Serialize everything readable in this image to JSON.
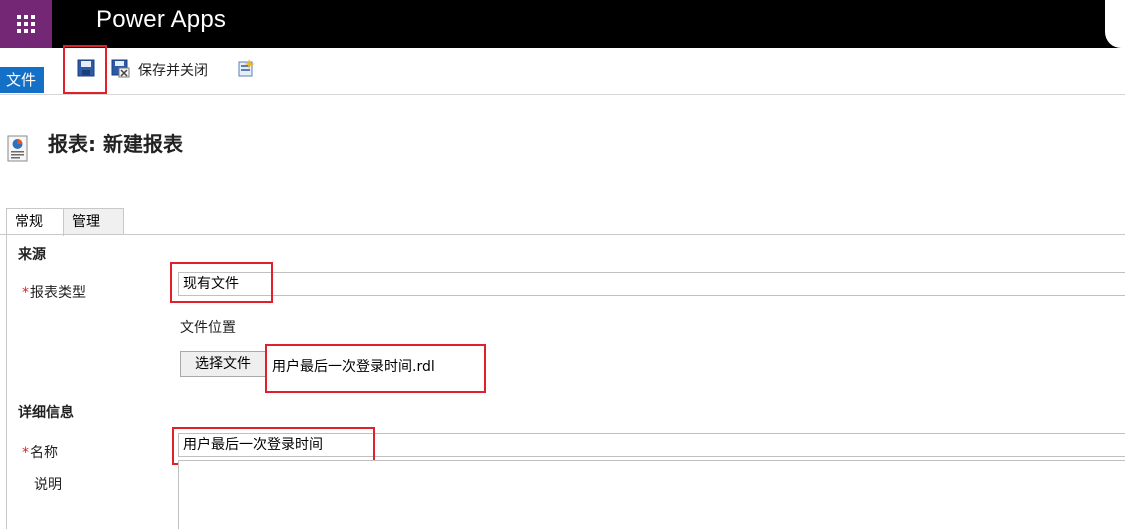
{
  "header": {
    "app_title": "Power Apps"
  },
  "command_bar": {
    "file_tab": "文件",
    "save_and_close": "保存并关闭"
  },
  "page": {
    "title": "报表: 新建报表"
  },
  "tabs": [
    {
      "label": "常规"
    },
    {
      "label": "管理"
    }
  ],
  "source_section": {
    "heading": "来源",
    "report_type_label": "报表类型",
    "report_type_value": "现有文件",
    "file_location_label": "文件位置",
    "choose_file_button": "选择文件",
    "chosen_file": "用户最后一次登录时间.rdl"
  },
  "details_section": {
    "heading": "详细信息",
    "name_label": "名称",
    "name_value": "用户最后一次登录时间",
    "description_label": "说明",
    "description_value": ""
  },
  "required_marker": "*",
  "colors": {
    "accent": "#1470c6",
    "waffle": "#742774",
    "highlight": "#e0202a"
  }
}
